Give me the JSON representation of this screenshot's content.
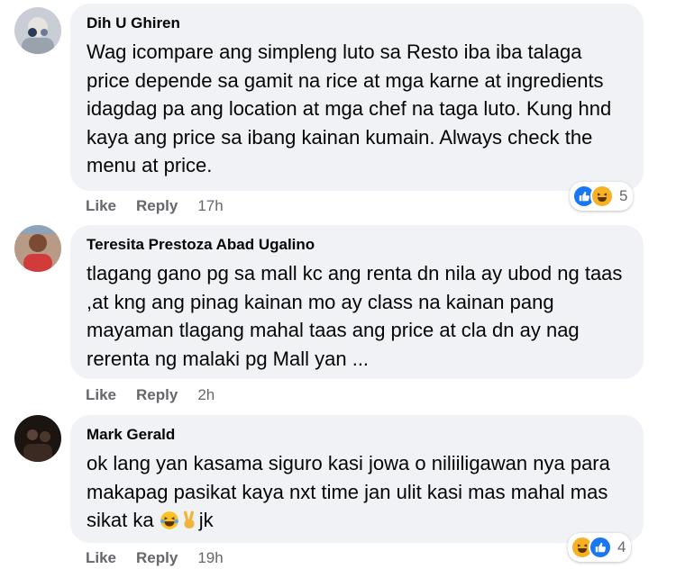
{
  "comments": [
    {
      "author": "Dih U Ghiren",
      "text": "Wag icompare ang simpleng luto sa Resto iba iba talaga price depende sa gamit na rice at mga karne at ingredients idagdag pa ang location at mga chef na taga luto. Kung hnd kaya ang price sa ibang kainan kumain. Always check the menu at price.",
      "like_label": "Like",
      "reply_label": "Reply",
      "time": "17h",
      "reaction_count": "5",
      "reactions": [
        "like-icon",
        "haha-icon"
      ]
    },
    {
      "author": "Teresita Prestoza Abad Ugalino",
      "text": "tlagang gano pg sa mall kc ang renta dn nila ay ubod ng taas ,at kng ang pinag kainan mo ay class na kainan pang mayaman tlagang mahal taas ang price at cla dn ay nag rerenta ng malaki pg Mall yan ...",
      "like_label": "Like",
      "reply_label": "Reply",
      "time": "2h"
    },
    {
      "author": "Mark Gerald",
      "text_before": "ok lang yan kasama siguro kasi jowa o niliiligawan nya para makapag pasikat kaya nxt time jan ulit kasi mas mahal mas sikat ka",
      "text_after": "jk",
      "like_label": "Like",
      "reply_label": "Reply",
      "time": "19h",
      "reaction_count": "4",
      "reactions": [
        "haha-icon",
        "like-icon"
      ]
    }
  ],
  "colors": {
    "bubble_bg": "#f0f2f5",
    "secondary_text": "#65676b",
    "like_blue": "#1877f2",
    "haha_yellow": "#f7b125"
  }
}
